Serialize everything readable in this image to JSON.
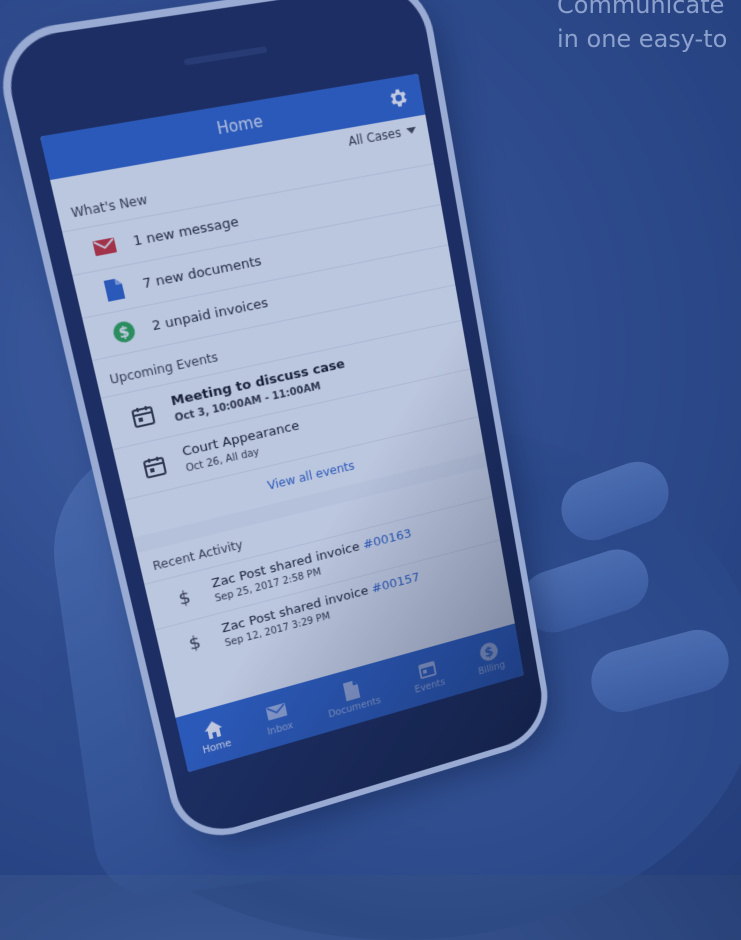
{
  "tagline": {
    "line1": "Communicate",
    "line2": "in one easy-to"
  },
  "app": {
    "title": "Home",
    "settings_icon": "gear-icon",
    "filter_label": "All Cases"
  },
  "whats_new": {
    "header": "What's New",
    "items": [
      {
        "icon": "envelope-icon",
        "label": "1 new message",
        "color": "#d22b2b"
      },
      {
        "icon": "document-icon",
        "label": "7 new documents",
        "color": "#2f62c6"
      },
      {
        "icon": "dollar-icon",
        "label": "2 unpaid invoices",
        "color": "#2eaa4a"
      }
    ]
  },
  "upcoming_events": {
    "header": "Upcoming Events",
    "items": [
      {
        "title": "Meeting to discuss case",
        "time": "Oct 3, 10:00AM - 11:00AM"
      },
      {
        "title": "Court Appearance",
        "time": "Oct 26, All day"
      }
    ],
    "view_all": "View all events"
  },
  "recent_activity": {
    "header": "Recent Activity",
    "items": [
      {
        "text": "Zac Post shared invoice ",
        "link": "#00163",
        "time": "Sep 25, 2017 2:58 PM"
      },
      {
        "text": "Zac Post shared invoice ",
        "link": "#00157",
        "time": "Sep 12, 2017 3:29 PM"
      }
    ]
  },
  "tabs": [
    {
      "label": "Home",
      "icon": "home-icon",
      "active": true
    },
    {
      "label": "Inbox",
      "icon": "inbox-icon",
      "active": false
    },
    {
      "label": "Documents",
      "icon": "document-icon",
      "active": false
    },
    {
      "label": "Events",
      "icon": "calendar-icon",
      "active": false
    },
    {
      "label": "Billing",
      "icon": "dollar-icon",
      "active": false
    }
  ],
  "colors": {
    "brand_blue": "#2f62c6",
    "alert_red": "#d22b2b",
    "money_green": "#2eaa4a"
  }
}
